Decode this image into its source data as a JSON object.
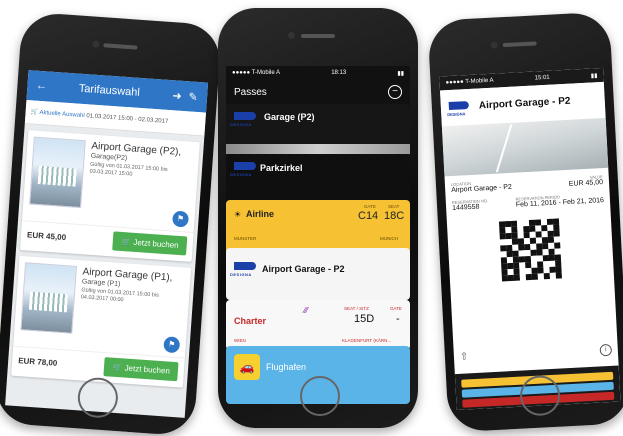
{
  "phone1": {
    "title": "Tarifauswahl",
    "selection_link": "Aktuelle Auswahl",
    "selection_range": "01.03.2017 15:00 - 02.03.2017",
    "offers": [
      {
        "name": "Airport Garage (P2),",
        "sub": "Garage(P2)",
        "valid": "Gültig von 01.03.2017 15:00 bis 03.03.2017 15:00",
        "price": "EUR 45,00",
        "button": "Jetzt buchen"
      },
      {
        "name": "Airport Garage (P1),",
        "sub": "Garage (P1)",
        "valid": "Gültig von 01.03.2017 15:00 bis 04.03.2017 00:00",
        "price": "EUR 78,00",
        "button": "Jetzt buchen"
      }
    ]
  },
  "phone2": {
    "carrier": "●●●●● T-Mobile A",
    "time": "18:13",
    "header": "Passes",
    "passes": {
      "p1_title": "Garage (P2)",
      "p2_title": "Parkzirkel",
      "airline_title": "Airline",
      "airline_gate_label": "GATE",
      "airline_gate": "C14",
      "airline_seat_label": "SEAT",
      "airline_seat": "18C",
      "airline_from": "MUNSTER",
      "airline_to": "MUNICH",
      "p4_title": "Airport Garage - P2",
      "charter_title": "Charter",
      "charter_seat_label": "SEAT / SITZ",
      "charter_seat": "15D",
      "charter_gate_label": "GATE",
      "charter_gate": "-",
      "charter_from": "WIEN",
      "charter_to": "KLAGENFURT (KÄRN...",
      "flughafen_title": "Flughafen"
    },
    "logo_text": "DESIGNA"
  },
  "phone3": {
    "carrier": "●●●●● T-Mobile A",
    "time": "15:01",
    "title": "Airport Garage - P2",
    "logo_text": "DESIGNA",
    "location_label": "LOCATION",
    "location": "Airport Garage - P2",
    "value_label": "VALUE",
    "value": "EUR 45,00",
    "reservation_label": "RESERVATION NO.",
    "reservation": "1449558",
    "period_label": "RESERVATION PERIOD",
    "period": "Feb 11, 2016 - Feb 21, 2016"
  },
  "colors": {
    "accent": "#2f77c6",
    "buy": "#4caf50",
    "airline": "#f6c233",
    "designa": "#1b3fa8"
  }
}
